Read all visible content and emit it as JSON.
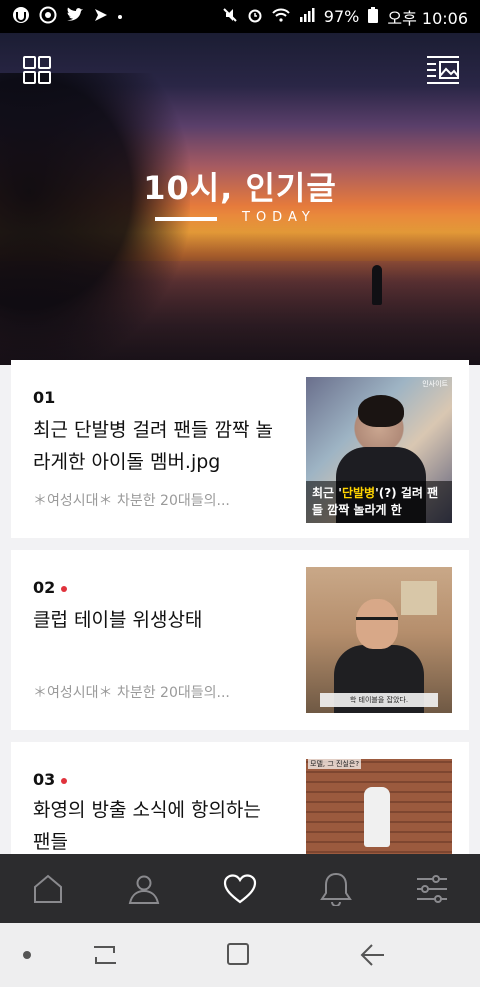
{
  "status_bar": {
    "battery": "97%",
    "time": "오후 10:06",
    "icons_left": [
      "app-icon",
      "target-icon",
      "twitter-icon",
      "check-icon",
      "dot-icon"
    ],
    "icons_right": [
      "mute-icon",
      "alarm-icon",
      "wifi-icon",
      "signal-icon",
      "battery-icon"
    ]
  },
  "hero": {
    "title": "10시, 인기글",
    "subtitle": "TODAY"
  },
  "posts": [
    {
      "num": "01",
      "is_new": false,
      "title": "최근 단발병 걸려 팬들 깜짝 놀라게한 아이돌 멤버.jpg",
      "meta": "＊여성시대＊ 차분한 20대들의...",
      "thumb_caption_prefix": "최근 '",
      "thumb_caption_highlight": "단발병",
      "thumb_caption_suffix": "'(?) 걸려 팬들 깜짝 놀라게 한",
      "thumb_tag": "인사이트"
    },
    {
      "num": "02",
      "is_new": true,
      "title": "클럽 테이블 위생상태",
      "meta": "＊여성시대＊ 차분한 20대들의...",
      "thumb_caption": "학 테이블을 잡았다."
    },
    {
      "num": "03",
      "is_new": true,
      "title": "화영의 방출 소식에 항의하는 팬들",
      "thumb_caption": "모델, 그 진실은?"
    }
  ],
  "bottom_nav": [
    "home-icon",
    "profile-icon",
    "heart-icon",
    "bell-icon",
    "settings-sliders-icon"
  ],
  "system_nav": [
    "dot-icon",
    "recent-apps-icon",
    "home-square-icon",
    "back-icon"
  ],
  "colors": {
    "accent_dot": "#e0323c",
    "bottom_nav_bg": "#2c2c2e",
    "highlight": "#ffd400"
  }
}
